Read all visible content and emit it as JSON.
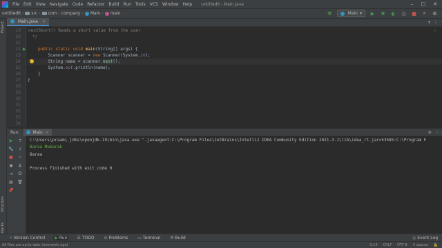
{
  "menubar": {
    "items": [
      "File",
      "Edit",
      "View",
      "Navigate",
      "Code",
      "Refactor",
      "Build",
      "Run",
      "Tools",
      "VCS",
      "Window",
      "Help"
    ],
    "title": "untitled6 - Main.java"
  },
  "navbar": {
    "crumbs": [
      "untitled6",
      "src",
      "com",
      "company",
      "Main",
      "main"
    ],
    "run_config": "Main"
  },
  "left_strip": {
    "project": "Project",
    "structure": "Structure",
    "bookmarks": "Bookmarks"
  },
  "editor": {
    "tab_label": "Main.java",
    "lines": [
      {
        "n": "19",
        "text": "nextShort() Reads a short value from the user"
      },
      {
        "n": "20",
        "text": "*/"
      },
      {
        "n": "21",
        "text": ""
      },
      {
        "n": "22",
        "kw": "public static void ",
        "method": "main",
        "rest": "(String[] args) {"
      },
      {
        "n": "23",
        "text": "    Scanner scanner = ",
        "kw2": "new ",
        "rest": "Scanner(System.",
        "static": "in",
        "tail": ");"
      },
      {
        "n": "24",
        "pre": "    String name = scanner.",
        "word": "next",
        "post": "();"
      },
      {
        "n": "25",
        "pre": "    System.",
        "static": "out",
        "post": ".println(name);"
      },
      {
        "n": "26",
        "text": "}"
      },
      {
        "n": "27",
        "text": "}"
      },
      {
        "n": "28",
        "text": ""
      },
      {
        "n": "29",
        "text": ""
      },
      {
        "n": "30",
        "text": ""
      },
      {
        "n": "31",
        "text": ""
      },
      {
        "n": "32",
        "text": ""
      },
      {
        "n": "33",
        "text": ""
      },
      {
        "n": "34",
        "text": ""
      }
    ]
  },
  "run_panel": {
    "title": "Run:",
    "tab_label": "Main",
    "console": {
      "command": "C:\\Users\\praam\\.jdks\\openjdk-19\\bin\\java.exe \"-javaagent:C:\\Program Files\\JetBrains\\IntelliJ IDEA Community Edition 2021.3.1\\lib\\idea_rt.jar=53585:C:\\Program F",
      "input": "Baraa Mubarak",
      "output": "Baraa",
      "exit": "Process finished with exit code 0"
    }
  },
  "bottom_tabs": {
    "version_control": "Version Control",
    "run": "Run",
    "todo": "TODO",
    "problems": "Problems",
    "terminal": "Terminal",
    "build": "Build",
    "event_log": "Event Log"
  },
  "statusbar": {
    "message": "All files are up-to-date (moments ago)",
    "position": "2:14",
    "line_sep": "CRLF",
    "encoding": "UTF-8",
    "indent": "4 spaces"
  },
  "colors": {
    "accent": "#4a88c7",
    "run_green": "#499c54",
    "keyword": "#cc7832",
    "method": "#ffc66d",
    "static_field": "#9876aa"
  }
}
